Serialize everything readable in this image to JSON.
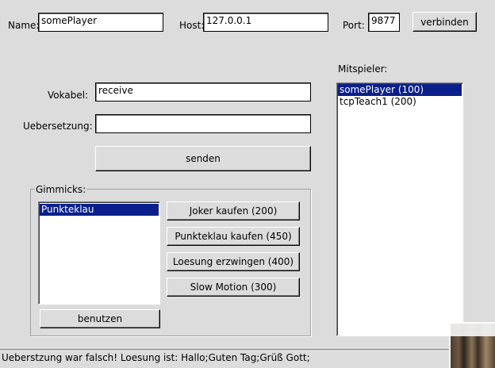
{
  "connection": {
    "name_label": "Name:",
    "name_value": "somePlayer",
    "host_label": "Host:",
    "host_value": "127.0.0.1",
    "port_label": "Port:",
    "port_value": "9877",
    "connect_button": "verbinden"
  },
  "quiz": {
    "vokabel_label": "Vokabel:",
    "vokabel_value": "receive",
    "uebersetzung_label": "Uebersetzung:",
    "uebersetzung_value": "",
    "send_button": "senden"
  },
  "gimmicks": {
    "title": "Gimmicks:",
    "list": [
      {
        "label": "Punkteklau",
        "selected": true
      }
    ],
    "use_button": "benutzen",
    "buttons": {
      "joker": "Joker kaufen (200)",
      "punkteklau": "Punkteklau kaufen (450)",
      "loesung": "Loesung erzwingen (400)",
      "slowmotion": "Slow Motion (300)"
    }
  },
  "players": {
    "title": "Mitspieler:",
    "list": [
      {
        "label": "somePlayer (100)",
        "selected": true
      },
      {
        "label": "tcpTeach1 (200)",
        "selected": false
      }
    ]
  },
  "status": {
    "message": "Ueberstzung war falsch! Loesung ist: Hallo;Guten Tag;Grüß Gott;"
  },
  "colors": {
    "background": "#dcdcdc",
    "selection": "#0a1f8c"
  }
}
